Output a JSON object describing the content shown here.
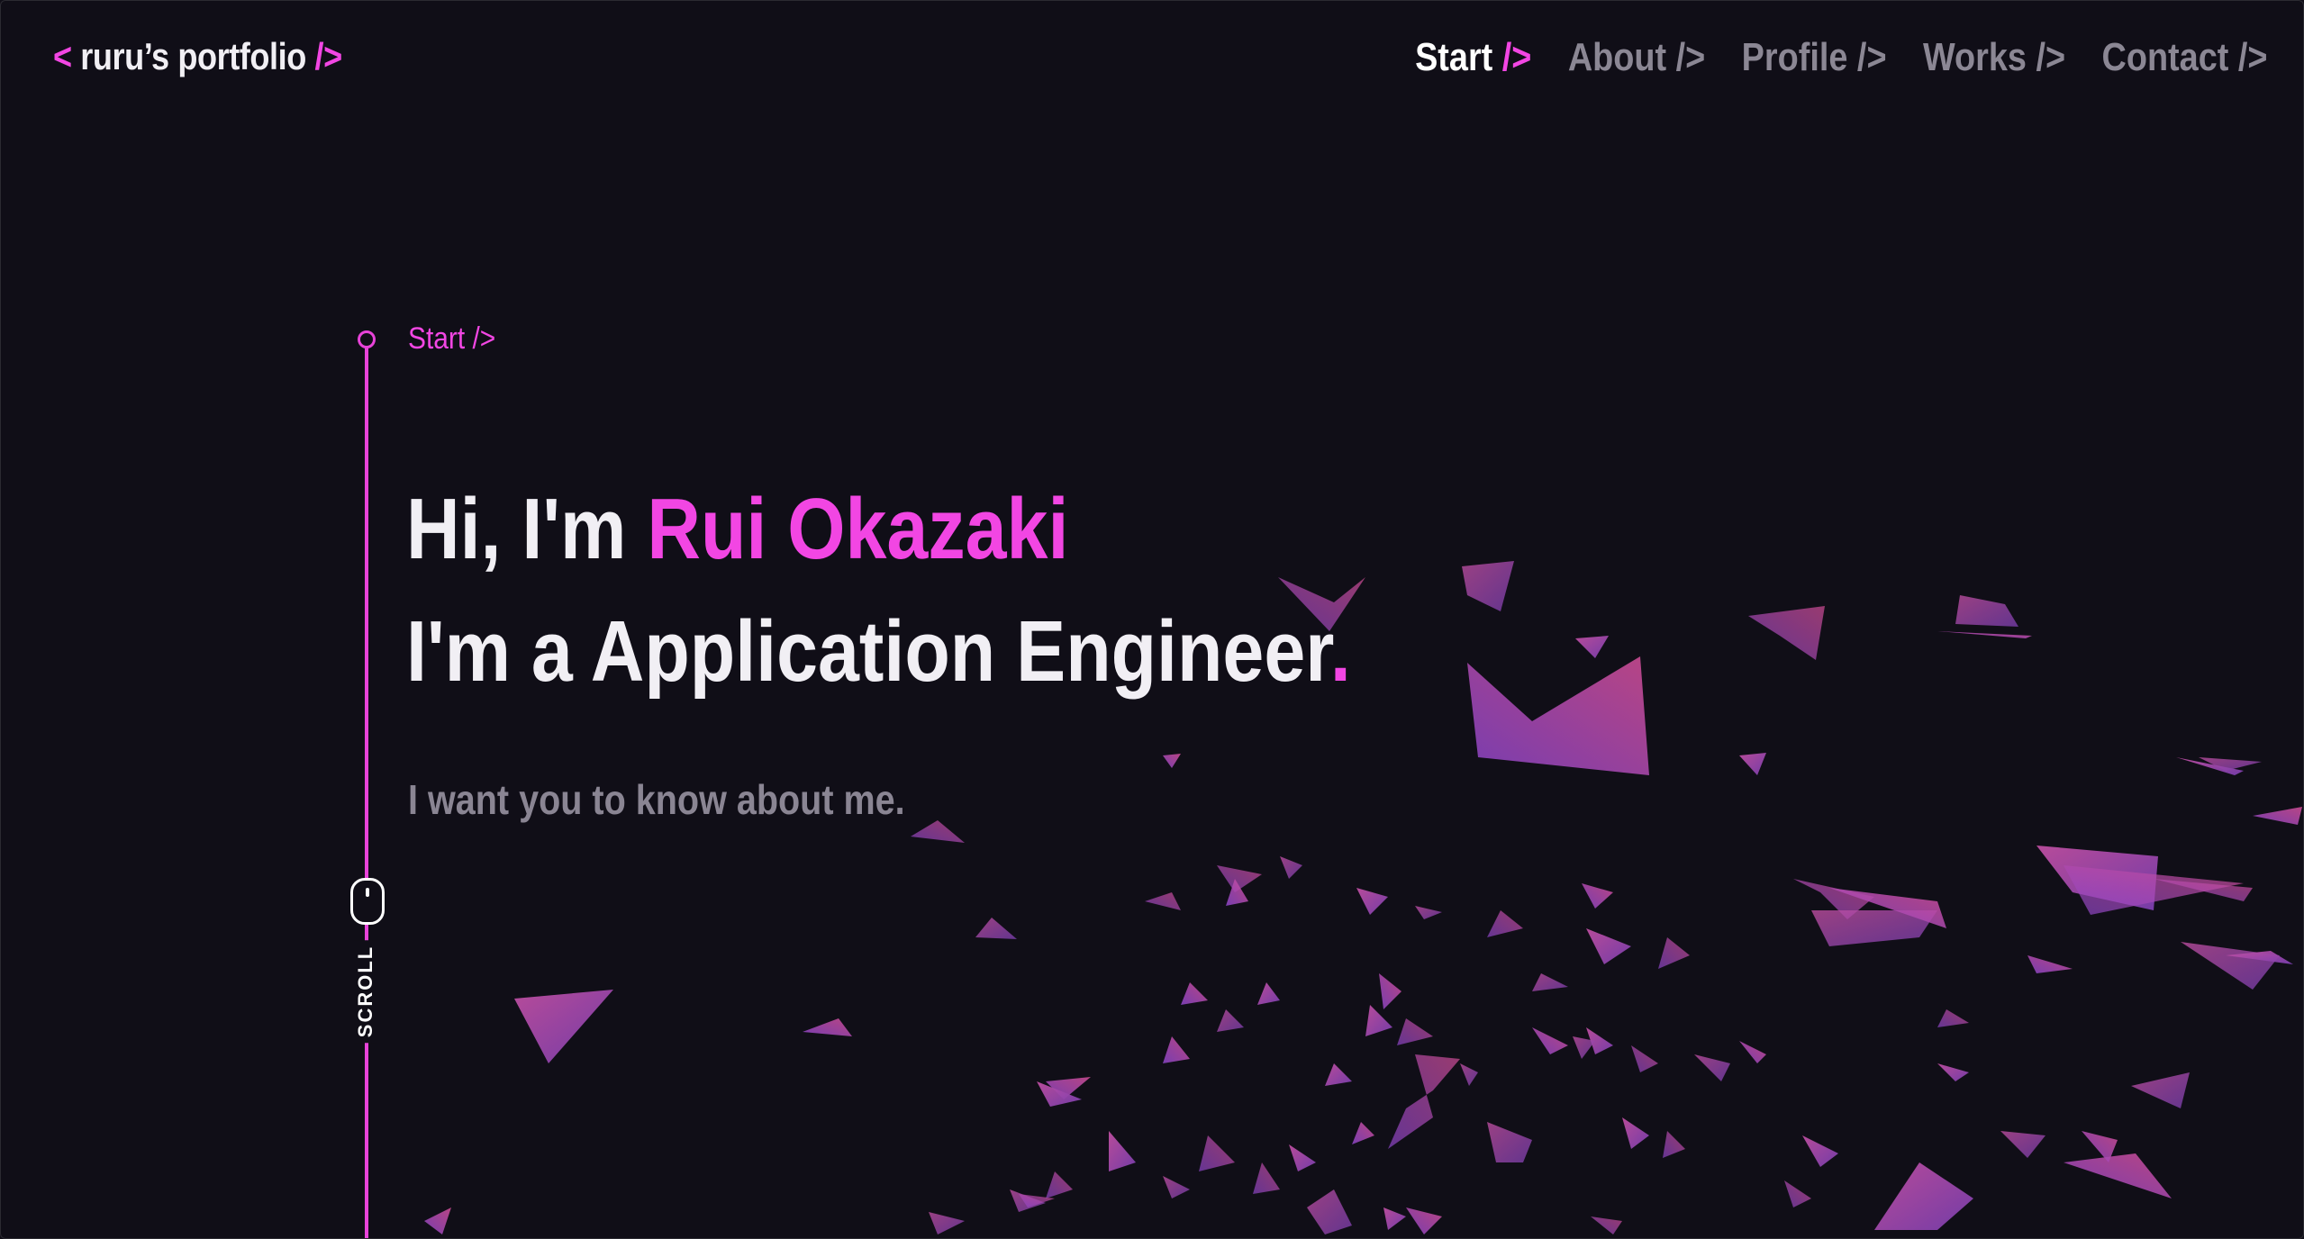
{
  "header": {
    "logo_open": "<",
    "logo_text": " ruru’s portfolio ",
    "logo_close": "/>",
    "nav": [
      {
        "label": "Start",
        "slash": " />",
        "active": true
      },
      {
        "label": "About",
        "slash": " />",
        "active": false
      },
      {
        "label": "Profile",
        "slash": " />",
        "active": false
      },
      {
        "label": "Works",
        "slash": " />",
        "active": false
      },
      {
        "label": "Contact",
        "slash": " />",
        "active": false
      }
    ]
  },
  "section": {
    "label": "Start />"
  },
  "hero": {
    "greeting": "Hi, I'm ",
    "name": "Rui Okazaki",
    "role": "I'm a Application Engineer",
    "role_dot": ".",
    "subtitle": "I want you to know about me."
  },
  "scroll": {
    "label": "SCROLL"
  },
  "colors": {
    "background": "#100e17",
    "accent": "#f246e3",
    "muted": "#8b8794",
    "text": "#f1eff4"
  },
  "icons": [
    "mouse-scroll-icon"
  ]
}
